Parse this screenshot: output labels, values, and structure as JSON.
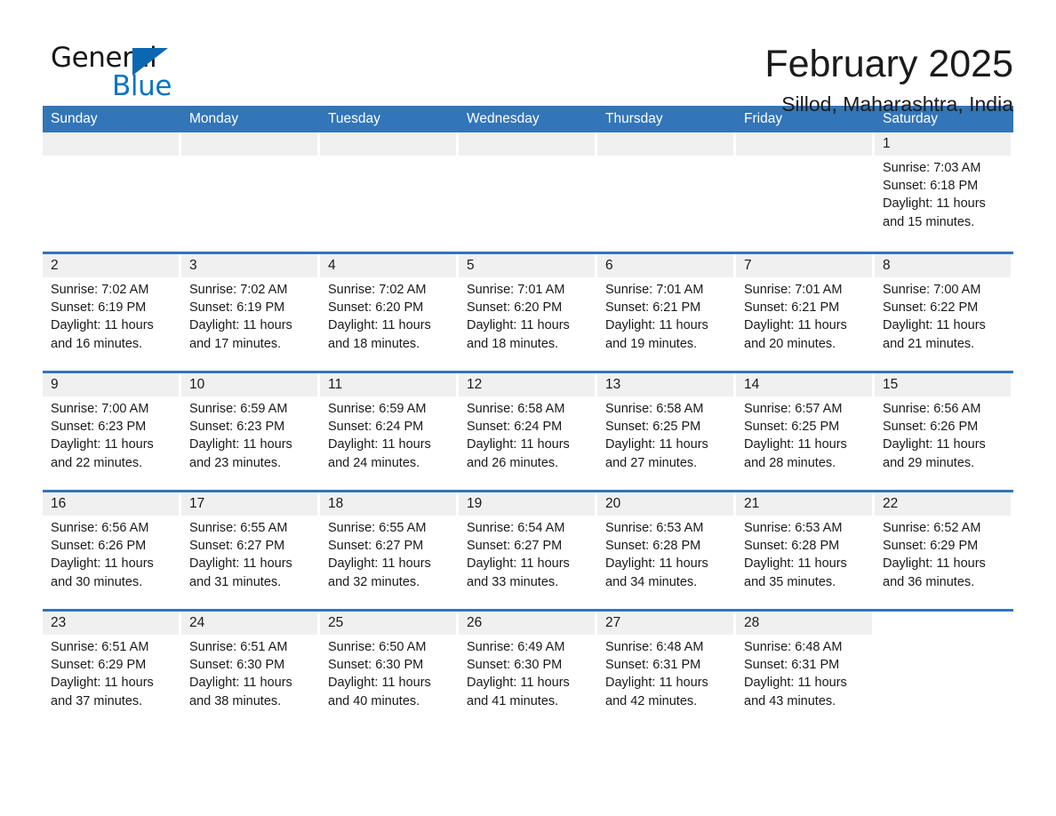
{
  "brand": {
    "name_part1": "General",
    "name_part2": "Blue",
    "triangle_color": "#0b67b2",
    "blue_text_color": "#0b74c4"
  },
  "header": {
    "month_title": "February 2025",
    "location": "Sillod, Maharashtra, India"
  },
  "theme": {
    "header_blue": "#3275b8",
    "daynum_band": "#f0f0f0",
    "text": "#1a1a1a"
  },
  "calendar": {
    "weekdays": [
      "Sunday",
      "Monday",
      "Tuesday",
      "Wednesday",
      "Thursday",
      "Friday",
      "Saturday"
    ],
    "weeks": [
      [
        {
          "day": "",
          "lines": []
        },
        {
          "day": "",
          "lines": []
        },
        {
          "day": "",
          "lines": []
        },
        {
          "day": "",
          "lines": []
        },
        {
          "day": "",
          "lines": []
        },
        {
          "day": "",
          "lines": []
        },
        {
          "day": "1",
          "lines": [
            "Sunrise: 7:03 AM",
            "Sunset: 6:18 PM",
            "Daylight: 11 hours",
            "and 15 minutes."
          ]
        }
      ],
      [
        {
          "day": "2",
          "lines": [
            "Sunrise: 7:02 AM",
            "Sunset: 6:19 PM",
            "Daylight: 11 hours",
            "and 16 minutes."
          ]
        },
        {
          "day": "3",
          "lines": [
            "Sunrise: 7:02 AM",
            "Sunset: 6:19 PM",
            "Daylight: 11 hours",
            "and 17 minutes."
          ]
        },
        {
          "day": "4",
          "lines": [
            "Sunrise: 7:02 AM",
            "Sunset: 6:20 PM",
            "Daylight: 11 hours",
            "and 18 minutes."
          ]
        },
        {
          "day": "5",
          "lines": [
            "Sunrise: 7:01 AM",
            "Sunset: 6:20 PM",
            "Daylight: 11 hours",
            "and 18 minutes."
          ]
        },
        {
          "day": "6",
          "lines": [
            "Sunrise: 7:01 AM",
            "Sunset: 6:21 PM",
            "Daylight: 11 hours",
            "and 19 minutes."
          ]
        },
        {
          "day": "7",
          "lines": [
            "Sunrise: 7:01 AM",
            "Sunset: 6:21 PM",
            "Daylight: 11 hours",
            "and 20 minutes."
          ]
        },
        {
          "day": "8",
          "lines": [
            "Sunrise: 7:00 AM",
            "Sunset: 6:22 PM",
            "Daylight: 11 hours",
            "and 21 minutes."
          ]
        }
      ],
      [
        {
          "day": "9",
          "lines": [
            "Sunrise: 7:00 AM",
            "Sunset: 6:23 PM",
            "Daylight: 11 hours",
            "and 22 minutes."
          ]
        },
        {
          "day": "10",
          "lines": [
            "Sunrise: 6:59 AM",
            "Sunset: 6:23 PM",
            "Daylight: 11 hours",
            "and 23 minutes."
          ]
        },
        {
          "day": "11",
          "lines": [
            "Sunrise: 6:59 AM",
            "Sunset: 6:24 PM",
            "Daylight: 11 hours",
            "and 24 minutes."
          ]
        },
        {
          "day": "12",
          "lines": [
            "Sunrise: 6:58 AM",
            "Sunset: 6:24 PM",
            "Daylight: 11 hours",
            "and 26 minutes."
          ]
        },
        {
          "day": "13",
          "lines": [
            "Sunrise: 6:58 AM",
            "Sunset: 6:25 PM",
            "Daylight: 11 hours",
            "and 27 minutes."
          ]
        },
        {
          "day": "14",
          "lines": [
            "Sunrise: 6:57 AM",
            "Sunset: 6:25 PM",
            "Daylight: 11 hours",
            "and 28 minutes."
          ]
        },
        {
          "day": "15",
          "lines": [
            "Sunrise: 6:56 AM",
            "Sunset: 6:26 PM",
            "Daylight: 11 hours",
            "and 29 minutes."
          ]
        }
      ],
      [
        {
          "day": "16",
          "lines": [
            "Sunrise: 6:56 AM",
            "Sunset: 6:26 PM",
            "Daylight: 11 hours",
            "and 30 minutes."
          ]
        },
        {
          "day": "17",
          "lines": [
            "Sunrise: 6:55 AM",
            "Sunset: 6:27 PM",
            "Daylight: 11 hours",
            "and 31 minutes."
          ]
        },
        {
          "day": "18",
          "lines": [
            "Sunrise: 6:55 AM",
            "Sunset: 6:27 PM",
            "Daylight: 11 hours",
            "and 32 minutes."
          ]
        },
        {
          "day": "19",
          "lines": [
            "Sunrise: 6:54 AM",
            "Sunset: 6:27 PM",
            "Daylight: 11 hours",
            "and 33 minutes."
          ]
        },
        {
          "day": "20",
          "lines": [
            "Sunrise: 6:53 AM",
            "Sunset: 6:28 PM",
            "Daylight: 11 hours",
            "and 34 minutes."
          ]
        },
        {
          "day": "21",
          "lines": [
            "Sunrise: 6:53 AM",
            "Sunset: 6:28 PM",
            "Daylight: 11 hours",
            "and 35 minutes."
          ]
        },
        {
          "day": "22",
          "lines": [
            "Sunrise: 6:52 AM",
            "Sunset: 6:29 PM",
            "Daylight: 11 hours",
            "and 36 minutes."
          ]
        }
      ],
      [
        {
          "day": "23",
          "lines": [
            "Sunrise: 6:51 AM",
            "Sunset: 6:29 PM",
            "Daylight: 11 hours",
            "and 37 minutes."
          ]
        },
        {
          "day": "24",
          "lines": [
            "Sunrise: 6:51 AM",
            "Sunset: 6:30 PM",
            "Daylight: 11 hours",
            "and 38 minutes."
          ]
        },
        {
          "day": "25",
          "lines": [
            "Sunrise: 6:50 AM",
            "Sunset: 6:30 PM",
            "Daylight: 11 hours",
            "and 40 minutes."
          ]
        },
        {
          "day": "26",
          "lines": [
            "Sunrise: 6:49 AM",
            "Sunset: 6:30 PM",
            "Daylight: 11 hours",
            "and 41 minutes."
          ]
        },
        {
          "day": "27",
          "lines": [
            "Sunrise: 6:48 AM",
            "Sunset: 6:31 PM",
            "Daylight: 11 hours",
            "and 42 minutes."
          ]
        },
        {
          "day": "28",
          "lines": [
            "Sunrise: 6:48 AM",
            "Sunset: 6:31 PM",
            "Daylight: 11 hours",
            "and 43 minutes."
          ]
        },
        {
          "day": "",
          "lines": []
        }
      ]
    ]
  }
}
